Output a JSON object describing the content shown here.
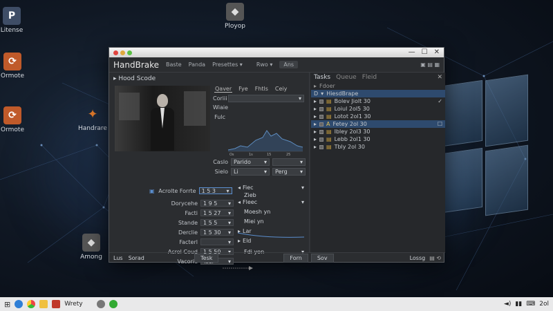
{
  "desktop": {
    "icons": [
      {
        "label": "Litense",
        "glyph": "P",
        "color": "#3e4d66"
      },
      {
        "label": "Ormote",
        "glyph": "⟳",
        "color": "#c05a2a"
      },
      {
        "label": "Ormote",
        "glyph": "⟳",
        "color": "#c05a2a"
      },
      {
        "label": "Handrare",
        "glyph": "✦",
        "color": "#1a1a1a"
      },
      {
        "label": "Among",
        "glyph": "◆",
        "color": "#555"
      },
      {
        "label": "Ployop",
        "glyph": "◆",
        "color": "#555"
      }
    ]
  },
  "window": {
    "title": "",
    "menu": {
      "app": "HandBrake",
      "items": [
        "Baste",
        "Panda",
        "Presettes ▾",
        "Rwo ▾",
        "Ans"
      ]
    },
    "source_label": "Hood Scode",
    "tabs": [
      "Qaver",
      "Fye",
      "Fhtls",
      "Ceiy"
    ],
    "dropdowns": {
      "top1": "",
      "top2": "",
      "row_a_label": "Caslo",
      "row_a_value": "Parido",
      "row_b_label": "Sielo",
      "row_b_value": "Li",
      "row_b_value2": "Perg"
    },
    "histogram_labels": [
      "Os",
      "1s",
      "15",
      "25"
    ],
    "left_labels": {
      "color": "Coriii",
      "width": "Wiaie",
      "fulc": "Fulc"
    },
    "form": {
      "title_label": "Acrolte Forrte",
      "rows": [
        {
          "label": "Dorycehe",
          "value": "1 9 5"
        },
        {
          "label": "Facti",
          "value": "1 5 27"
        },
        {
          "label": "Stande",
          "value": "1 5 5"
        },
        {
          "label": "Derclie",
          "value": "1 5 30"
        },
        {
          "label": "Facterl",
          "value": ""
        },
        {
          "label": "Acrol Coud",
          "value": "1 5 50"
        },
        {
          "label": "Vacorie",
          "value": "Tsel"
        }
      ],
      "first_value": "1 5 3"
    },
    "right_column": [
      {
        "text": "Fiec"
      },
      {
        "text": "Zieb"
      },
      {
        "text": "Fleec"
      },
      {
        "text": "Moesh yn"
      },
      {
        "text": "Miei yn"
      },
      {
        "text": "Lar"
      },
      {
        "text": "Eld"
      },
      {
        "text": "Fdi yon"
      }
    ],
    "footer": {
      "left1": "Lus",
      "left2": "Sorad",
      "btn1": "Tesk",
      "btn2": "Forn",
      "btn3": "Sov"
    },
    "queue": {
      "header": [
        "Tasks",
        "Queue",
        "Fleid"
      ],
      "sub": "Fdoer",
      "root": "HiesdBrape",
      "rows": [
        {
          "text": "Bolev Jiolt 30",
          "mark": "✓"
        },
        {
          "text": "Loiul 2ol5 30",
          "mark": ""
        },
        {
          "text": "Lotot 2ol1 30",
          "mark": ""
        },
        {
          "text": "Fetey 2ol 30",
          "mark": "☐",
          "selected": true
        },
        {
          "text": "Ibley 2ol3 30",
          "mark": ""
        },
        {
          "text": "Lebb 2ol1 30",
          "mark": ""
        },
        {
          "text": "Tbly 2ol 30",
          "mark": ""
        }
      ],
      "footer_label": "Lossg"
    }
  },
  "taskbar": {
    "app_label": "Wrety",
    "clock": "2ol"
  }
}
